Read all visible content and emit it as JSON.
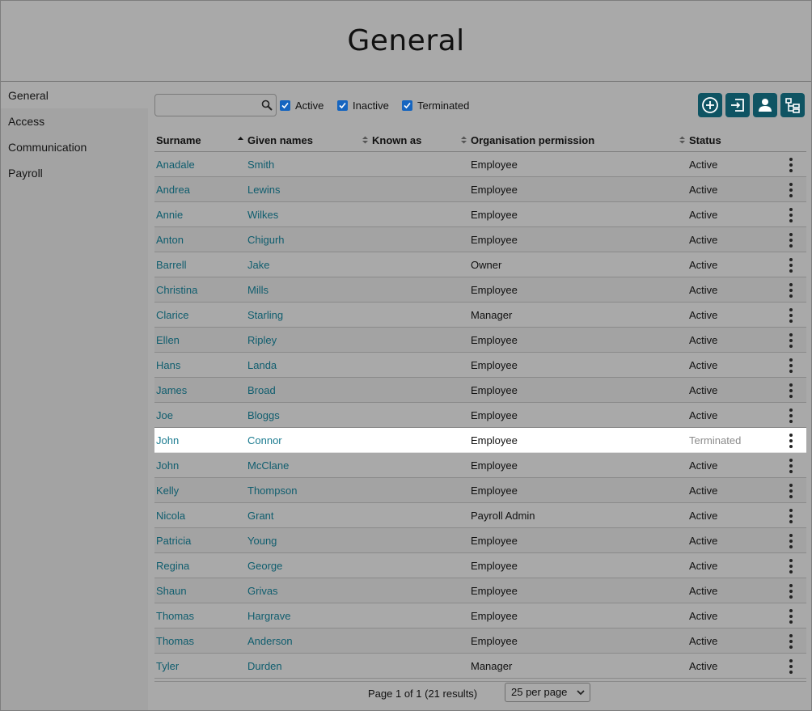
{
  "page": {
    "title": "General"
  },
  "sidebar": {
    "items": [
      {
        "label": "General"
      },
      {
        "label": "Access"
      },
      {
        "label": "Communication"
      },
      {
        "label": "Payroll"
      }
    ]
  },
  "toolbar": {
    "search_value": "",
    "filters": [
      {
        "label": "Active",
        "checked": true
      },
      {
        "label": "Inactive",
        "checked": true
      },
      {
        "label": "Terminated",
        "checked": true
      }
    ],
    "buttons": [
      "add-circle-icon",
      "import-icon",
      "person-icon",
      "hierarchy-icon"
    ],
    "accent": "#0f5463"
  },
  "table": {
    "headers": {
      "surname": "Surname",
      "given": "Given names",
      "known": "Known as",
      "permission": "Organisation permission",
      "status": "Status"
    },
    "rows": [
      {
        "surname": "Anadale",
        "given": "Smith",
        "known": "",
        "permission": "Employee",
        "status": "Active"
      },
      {
        "surname": "Andrea",
        "given": "Lewins",
        "known": "",
        "permission": "Employee",
        "status": "Active"
      },
      {
        "surname": "Annie",
        "given": "Wilkes",
        "known": "",
        "permission": "Employee",
        "status": "Active"
      },
      {
        "surname": "Anton",
        "given": "Chigurh",
        "known": "",
        "permission": "Employee",
        "status": "Active"
      },
      {
        "surname": "Barrell",
        "given": "Jake",
        "known": "",
        "permission": "Owner",
        "status": "Active"
      },
      {
        "surname": "Christina",
        "given": "Mills",
        "known": "",
        "permission": "Employee",
        "status": "Active"
      },
      {
        "surname": "Clarice",
        "given": "Starling",
        "known": "",
        "permission": "Manager",
        "status": "Active"
      },
      {
        "surname": "Ellen",
        "given": "Ripley",
        "known": "",
        "permission": "Employee",
        "status": "Active"
      },
      {
        "surname": "Hans",
        "given": "Landa",
        "known": "",
        "permission": "Employee",
        "status": "Active"
      },
      {
        "surname": "James",
        "given": "Broad",
        "known": "",
        "permission": "Employee",
        "status": "Active"
      },
      {
        "surname": "Joe",
        "given": "Bloggs",
        "known": "",
        "permission": "Employee",
        "status": "Active"
      },
      {
        "surname": "John",
        "given": "Connor",
        "known": "",
        "permission": "Employee",
        "status": "Terminated"
      },
      {
        "surname": "John",
        "given": "McClane",
        "known": "",
        "permission": "Employee",
        "status": "Active"
      },
      {
        "surname": "Kelly",
        "given": "Thompson",
        "known": "",
        "permission": "Employee",
        "status": "Active"
      },
      {
        "surname": "Nicola",
        "given": "Grant",
        "known": "",
        "permission": "Payroll Admin",
        "status": "Active"
      },
      {
        "surname": "Patricia",
        "given": "Young",
        "known": "",
        "permission": "Employee",
        "status": "Active"
      },
      {
        "surname": "Regina",
        "given": "George",
        "known": "",
        "permission": "Employee",
        "status": "Active"
      },
      {
        "surname": "Shaun",
        "given": "Grivas",
        "known": "",
        "permission": "Employee",
        "status": "Active"
      },
      {
        "surname": "Thomas",
        "given": "Hargrave",
        "known": "",
        "permission": "Employee",
        "status": "Active"
      },
      {
        "surname": "Thomas",
        "given": "Anderson",
        "known": "",
        "permission": "Employee",
        "status": "Active"
      },
      {
        "surname": "Tyler",
        "given": "Durden",
        "known": "",
        "permission": "Manager",
        "status": "Active"
      }
    ]
  },
  "pager": {
    "text": "Page 1 of 1 (21 results)",
    "per_page": "25 per page"
  }
}
